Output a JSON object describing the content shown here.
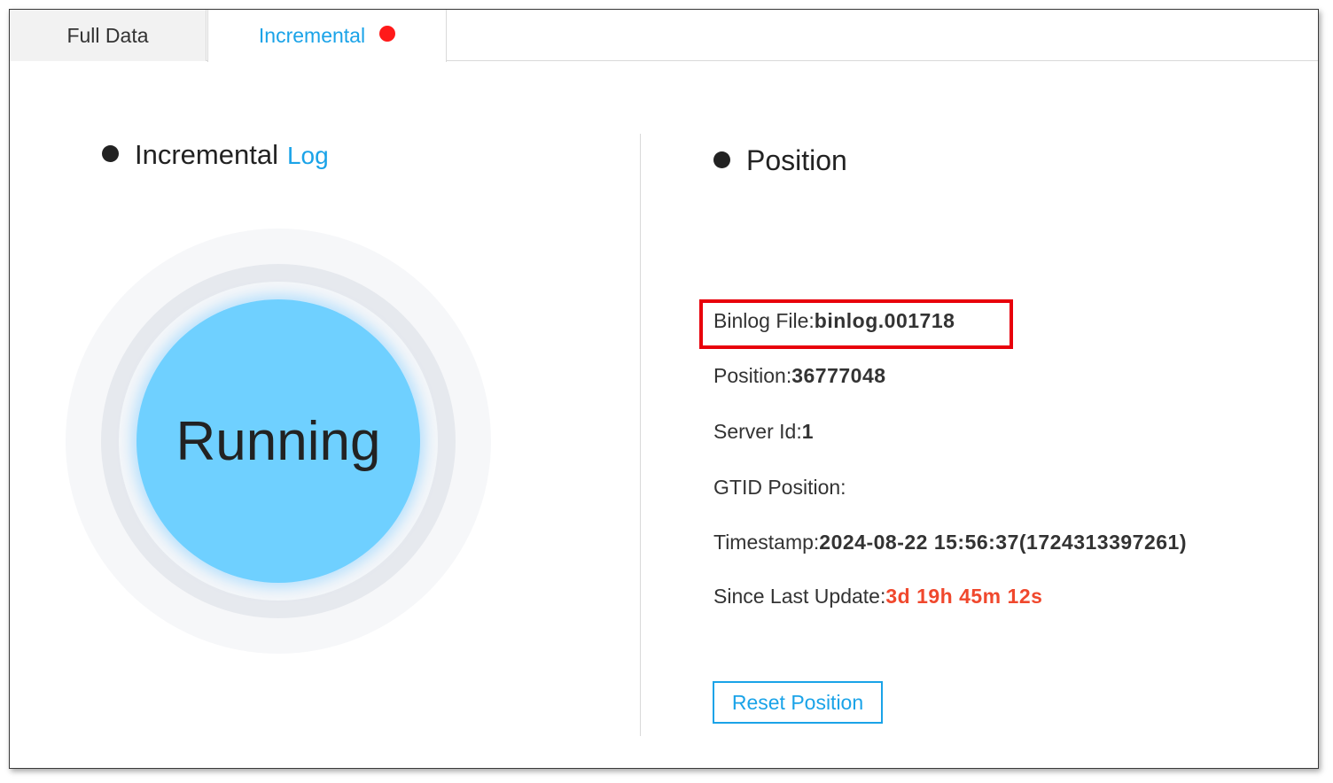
{
  "tabs": {
    "full_data": "Full Data",
    "incremental": "Incremental"
  },
  "left_panel": {
    "title": "Incremental",
    "log_link": "Log",
    "status": "Running"
  },
  "right_panel": {
    "title": "Position",
    "binlog_file_label": "Binlog File:",
    "binlog_file_value": "binlog.001718",
    "position_label": "Position:",
    "position_value": "36777048",
    "server_id_label": "Server Id:",
    "server_id_value": "1",
    "gtid_label": "GTID Position:",
    "gtid_value": "",
    "timestamp_label": "Timestamp:",
    "timestamp_value": "2024-08-22 15:56:37(1724313397261)",
    "since_label": "Since Last Update:",
    "since_value": "3d 19h 45m 12s",
    "reset_button": "Reset Position"
  },
  "colors": {
    "accent": "#1aa3e8",
    "status_circle": "#6fd0ff",
    "alert_dot": "#ff1a1a",
    "elapsed_text": "#f0482d",
    "highlight_box": "#e8000b"
  }
}
